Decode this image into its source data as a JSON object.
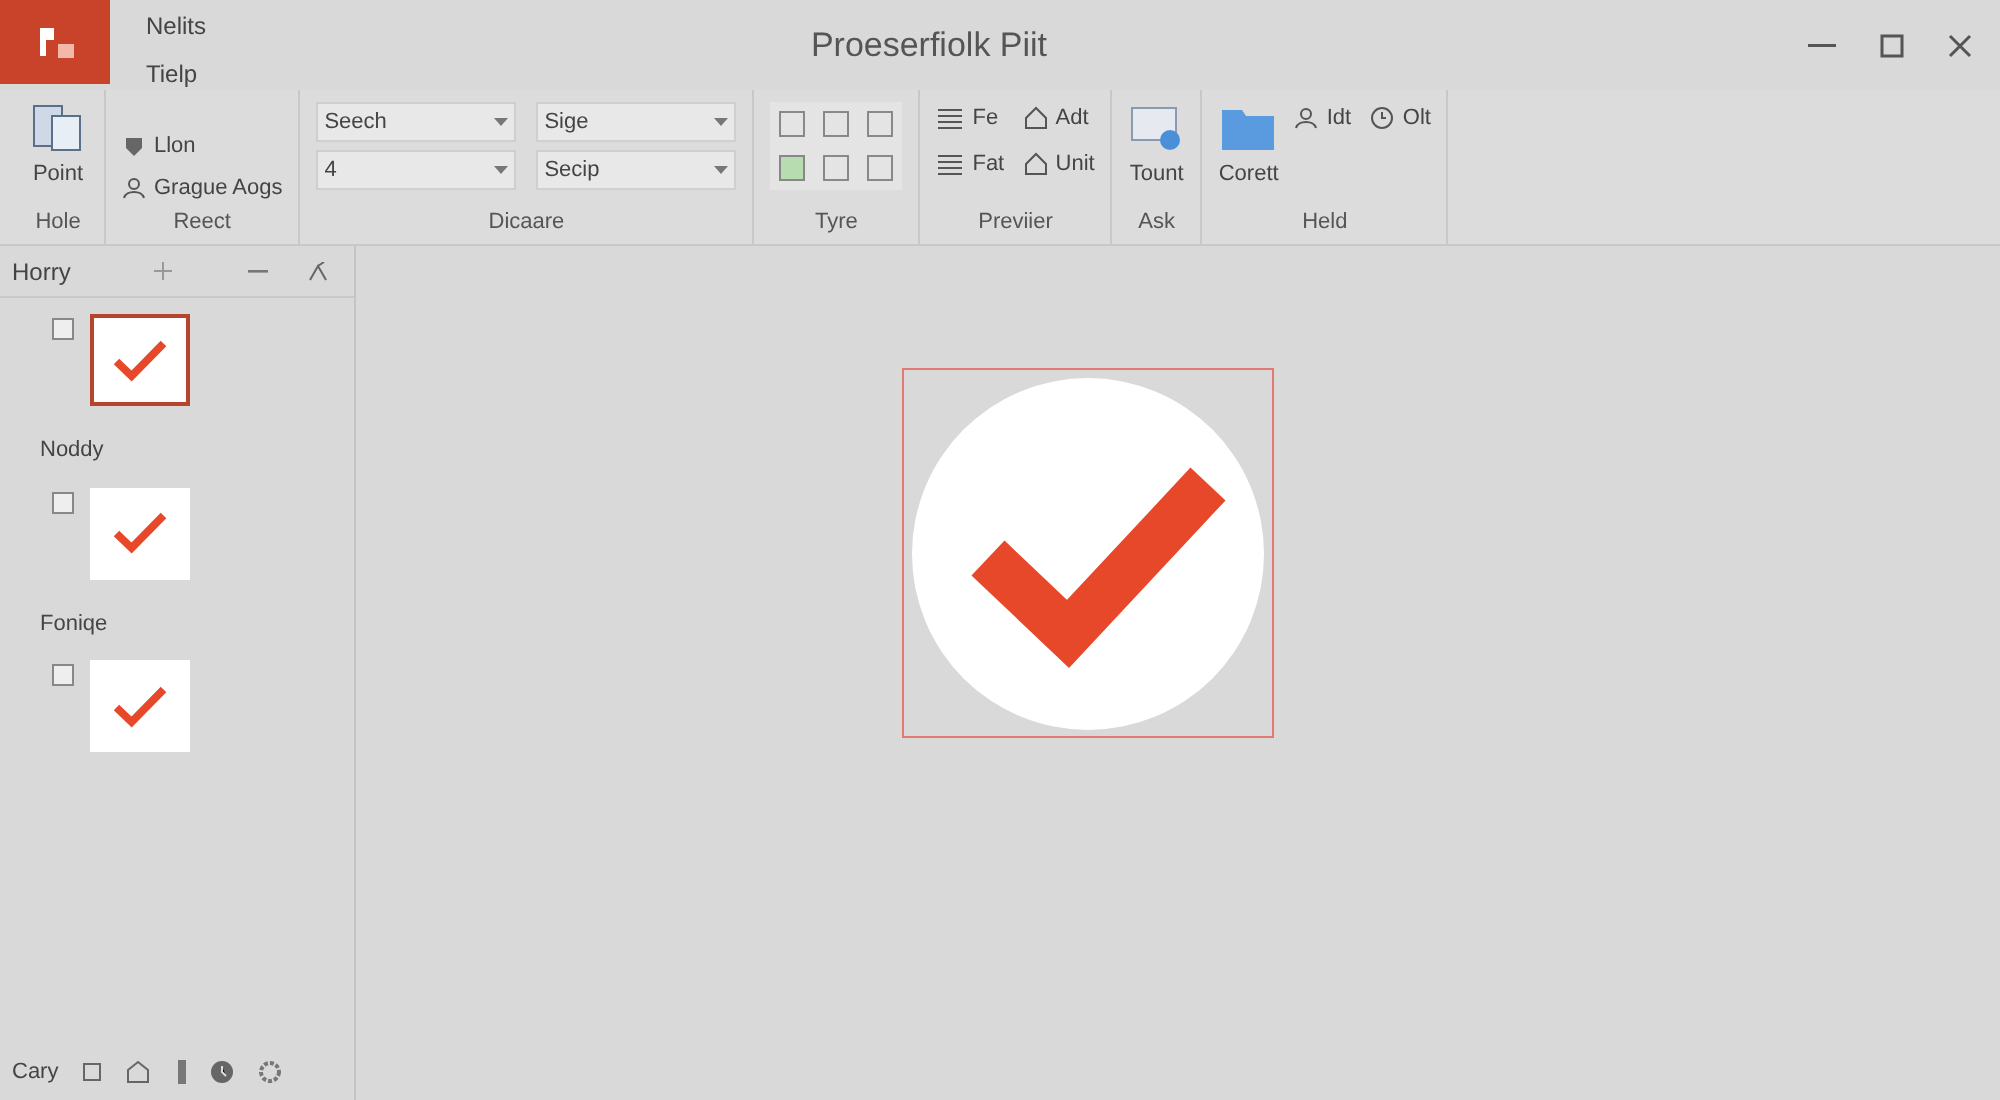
{
  "window": {
    "title": "Proeserfiolk Piit",
    "menu": [
      "Nelits",
      "Tielp"
    ]
  },
  "ribbon": [
    {
      "label": "Hole",
      "items": [
        {
          "kind": "large",
          "label": "Point"
        }
      ]
    },
    {
      "label": "Reect",
      "items": [
        {
          "kind": "small",
          "label": "Llon"
        },
        {
          "kind": "small",
          "label": "Grague Aogs"
        }
      ]
    },
    {
      "label": "Dicaare",
      "items": [
        {
          "kind": "field",
          "value": "Seech"
        },
        {
          "kind": "field",
          "value": "Sige"
        },
        {
          "kind": "field",
          "value": "4"
        },
        {
          "kind": "field",
          "value": "Secip"
        }
      ]
    },
    {
      "label": "Tyre",
      "items": [
        {
          "kind": "iconset"
        }
      ]
    },
    {
      "label": "Previier",
      "items": [
        {
          "kind": "small",
          "label": "Fe"
        },
        {
          "kind": "small",
          "label": "Adt"
        },
        {
          "kind": "small",
          "label": "Fat"
        },
        {
          "kind": "small",
          "label": "Unit"
        }
      ]
    },
    {
      "label": "Ask",
      "items": [
        {
          "kind": "large",
          "label": "Tount"
        }
      ]
    },
    {
      "label": "Held",
      "items": [
        {
          "kind": "large",
          "label": "Corett"
        },
        {
          "kind": "small",
          "label": "Idt"
        },
        {
          "kind": "small",
          "label": "Olt"
        }
      ]
    }
  ],
  "sidebar": {
    "title": "Horry",
    "slides": [
      {
        "selected": true,
        "checked": false
      },
      {
        "section": "Noddy",
        "selected": false,
        "checked": false
      },
      {
        "section": "Foniqe",
        "selected": false,
        "checked": false
      }
    ]
  },
  "canvas": {
    "shape": {
      "selected": true
    }
  },
  "status_bar": {
    "text": "Cary"
  }
}
